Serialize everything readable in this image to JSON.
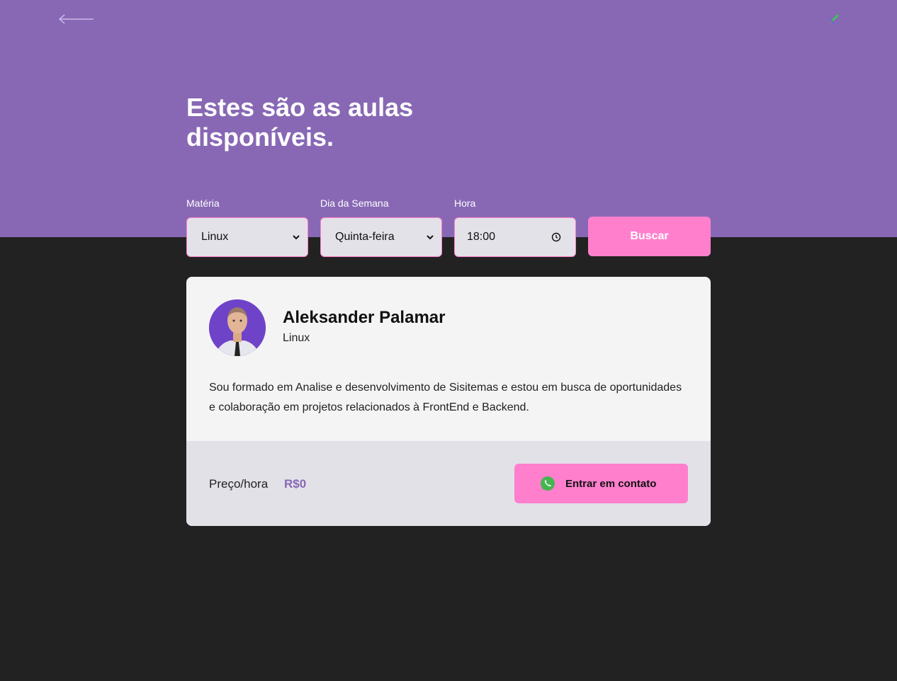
{
  "header": {
    "title": "Estes são as aulas disponíveis."
  },
  "filters": {
    "subject": {
      "label": "Matéria",
      "value": "Linux"
    },
    "weekday": {
      "label": "Dia da Semana",
      "value": "Quinta-feira"
    },
    "time": {
      "label": "Hora",
      "value": "18:00"
    },
    "search_label": "Buscar"
  },
  "teacher": {
    "name": "Aleksander Palamar",
    "subject": "Linux",
    "bio": "Sou formado em Analise e desenvolvimento de Sisitemas e estou em busca de oportunidades e colaboração em projetos relacionados à FrontEnd e Backend.",
    "price_label": "Preço/hora",
    "price_value": "R$0",
    "contact_label": "Entrar em contato"
  },
  "colors": {
    "header_bg": "#8868b4",
    "page_bg": "#222222",
    "accent_pink": "#ff7fcd",
    "price_purple": "#8868b4"
  },
  "icons": {
    "back": "arrow-left-icon",
    "logo": "rocket-icon",
    "dropdown": "chevron-down-icon",
    "time": "clock-icon",
    "contact": "whatsapp-icon"
  }
}
